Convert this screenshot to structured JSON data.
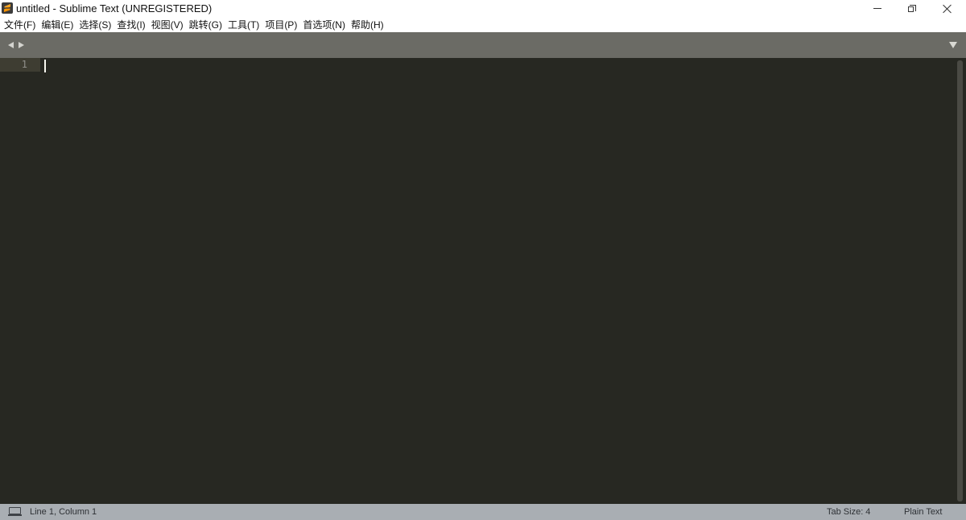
{
  "window": {
    "title": "untitled - Sublime Text (UNREGISTERED)",
    "app_icon": "sublime-text-logo",
    "controls": [
      "minimize-icon",
      "maximize-icon",
      "close-icon"
    ]
  },
  "menu": {
    "items": [
      {
        "label": "文件(F)"
      },
      {
        "label": "编辑(E)"
      },
      {
        "label": "选择(S)"
      },
      {
        "label": "查找(I)"
      },
      {
        "label": "视图(V)"
      },
      {
        "label": "跳转(G)"
      },
      {
        "label": "工具(T)"
      },
      {
        "label": "项目(P)"
      },
      {
        "label": "首选项(N)"
      },
      {
        "label": "帮助(H)"
      }
    ]
  },
  "tabbar": {
    "nav_icons": [
      "chevron-left-icon",
      "chevron-right-icon"
    ],
    "dropdown_icon": "chevron-down-icon"
  },
  "editor": {
    "line_numbers": [
      "1"
    ],
    "content": "",
    "theme_colors": {
      "background": "#272822",
      "gutter_current": "#3e3d32",
      "line_number": "#90908a",
      "caret": "#f8f8f0"
    }
  },
  "status": {
    "icon": "console-icon",
    "position": "Line 1, Column 1",
    "tab_size": "Tab Size: 4",
    "syntax": "Plain Text"
  }
}
